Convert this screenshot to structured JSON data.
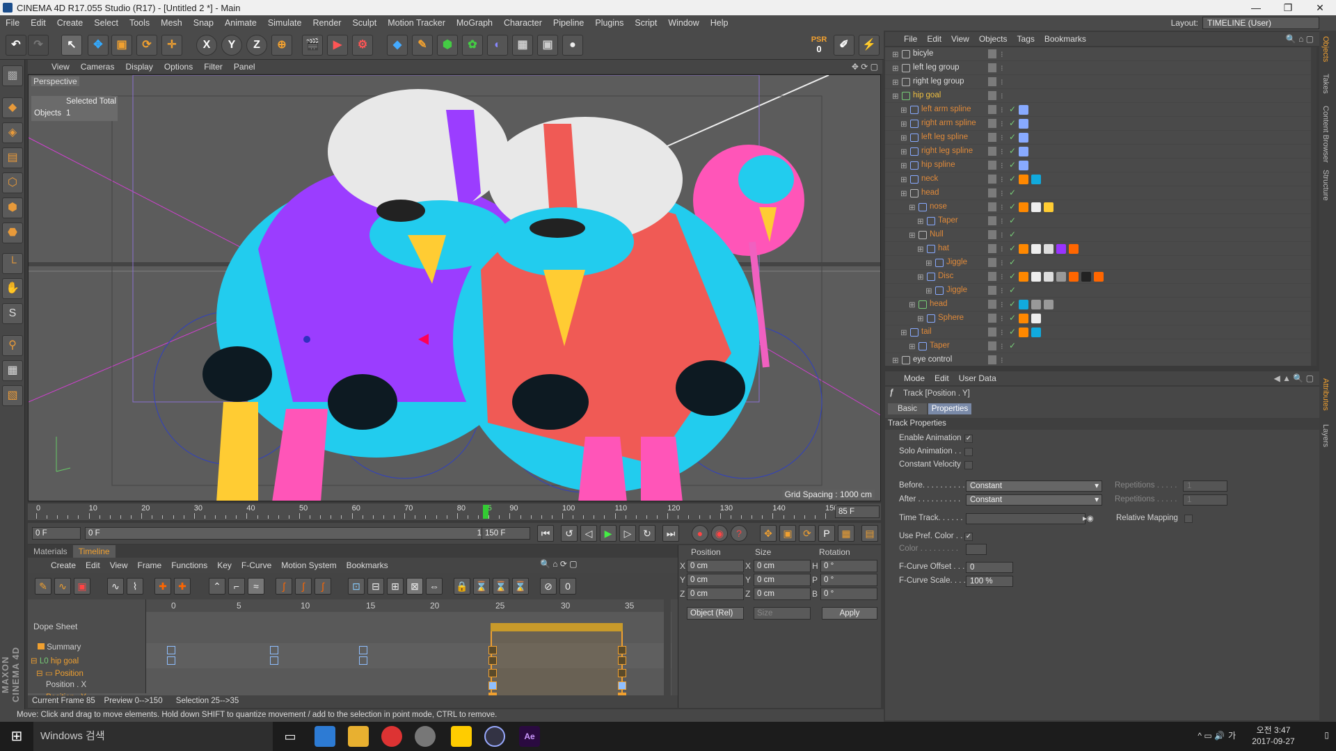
{
  "window": {
    "title": "CINEMA 4D R17.055 Studio (R17) - [Untitled 2 *] - Main",
    "min": "—",
    "max": "❐",
    "close": "✕"
  },
  "menu": [
    "File",
    "Edit",
    "Create",
    "Select",
    "Tools",
    "Mesh",
    "Snap",
    "Animate",
    "Simulate",
    "Render",
    "Sculpt",
    "Motion Tracker",
    "MoGraph",
    "Character",
    "Pipeline",
    "Plugins",
    "Script",
    "Window",
    "Help"
  ],
  "layout": {
    "label": "Layout:",
    "value": "TIMELINE (User)"
  },
  "psr": {
    "label": "PSR",
    "value": "0"
  },
  "viewport": {
    "menu": [
      "View",
      "Cameras",
      "Display",
      "Options",
      "Filter",
      "Panel"
    ],
    "label": "Perspective",
    "hud_header": "Selected Total",
    "hud_label": "Objects",
    "hud_value": "1",
    "grid_spacing": "Grid Spacing : 1000 cm"
  },
  "ruler": {
    "ticks": [
      "0",
      "10",
      "20",
      "30",
      "40",
      "50",
      "60",
      "70",
      "80",
      "85",
      "90",
      "100",
      "110",
      "120",
      "130",
      "140",
      "150"
    ],
    "current_frame": "85 F"
  },
  "transport": {
    "start": "0 F",
    "range_start": "0 F",
    "range_end": "150 F",
    "end": "150 F"
  },
  "bottom_tabs": [
    "Materials",
    "Timeline"
  ],
  "timeline_menu": [
    "Create",
    "Edit",
    "View",
    "Frame",
    "Functions",
    "Key",
    "F-Curve",
    "Motion System",
    "Bookmarks"
  ],
  "dope": {
    "title": "Dope Sheet",
    "ticks": [
      "0",
      "5",
      "10",
      "15",
      "20",
      "25",
      "30",
      "35"
    ],
    "tracks": [
      {
        "name": "Summary",
        "color": "#ddd"
      },
      {
        "name": "hip goal",
        "color": "#f0a030"
      },
      {
        "name": "Position",
        "color": "#f0a030"
      },
      {
        "name": "Position . X",
        "color": "#ddd"
      },
      {
        "name": "Position . Y",
        "color": "#f0a030"
      }
    ]
  },
  "timeline_status": {
    "current": "Current Frame  85",
    "preview": "Preview  0-->150",
    "selection": "Selection 25-->35"
  },
  "coords": {
    "headers": [
      "Position",
      "Size",
      "Rotation"
    ],
    "rows": [
      {
        "a": "X",
        "av": "0 cm",
        "b": "X",
        "bv": "0 cm",
        "c": "H",
        "cv": "0 °"
      },
      {
        "a": "Y",
        "av": "0 cm",
        "b": "Y",
        "bv": "0 cm",
        "c": "P",
        "cv": "0 °"
      },
      {
        "a": "Z",
        "av": "0 cm",
        "b": "Z",
        "bv": "0 cm",
        "c": "B",
        "cv": "0 °"
      }
    ],
    "mode": "Object (Rel)",
    "size_mode": "Size",
    "apply": "Apply"
  },
  "status": "Move: Click and drag to move elements. Hold down SHIFT to quantize movement / add to the selection in point mode, CTRL to remove.",
  "maxon": "MAXON CINEMA 4D",
  "objects_menu": [
    "File",
    "Edit",
    "View",
    "Objects",
    "Tags",
    "Bookmarks"
  ],
  "objects": [
    {
      "name": "bicyle",
      "indent": 0,
      "color": "#ddd",
      "icon": "#bbb",
      "tags": []
    },
    {
      "name": "left leg group",
      "indent": 0,
      "color": "#ddd",
      "icon": "#bbb",
      "tags": []
    },
    {
      "name": "right leg group",
      "indent": 0,
      "color": "#ddd",
      "icon": "#bbb",
      "tags": []
    },
    {
      "name": "hip goal",
      "indent": 0,
      "color": "#f0c040",
      "icon": "#7c7",
      "tags": []
    },
    {
      "name": "left arm spline",
      "indent": 1,
      "color": "#e08a3a",
      "icon": "#8af",
      "tags": [
        "#8af"
      ]
    },
    {
      "name": "right arm spline",
      "indent": 1,
      "color": "#e08a3a",
      "icon": "#8af",
      "tags": [
        "#8af"
      ]
    },
    {
      "name": "left leg spline",
      "indent": 1,
      "color": "#e08a3a",
      "icon": "#8af",
      "tags": [
        "#8af"
      ]
    },
    {
      "name": "right leg spline",
      "indent": 1,
      "color": "#e08a3a",
      "icon": "#8af",
      "tags": [
        "#8af"
      ]
    },
    {
      "name": "hip spline",
      "indent": 1,
      "color": "#e08a3a",
      "icon": "#8af",
      "tags": [
        "#8af"
      ]
    },
    {
      "name": "neck",
      "indent": 1,
      "color": "#e08a3a",
      "icon": "#8af",
      "tags": [
        "#f80",
        "#1ad"
      ]
    },
    {
      "name": "head",
      "indent": 1,
      "color": "#e08a3a",
      "icon": "#bbb",
      "tags": []
    },
    {
      "name": "nose",
      "indent": 2,
      "color": "#e08a3a",
      "icon": "#8af",
      "tags": [
        "#f80",
        "#eee",
        "#fc3"
      ]
    },
    {
      "name": "Taper",
      "indent": 3,
      "color": "#e08a3a",
      "icon": "#8af",
      "tags": []
    },
    {
      "name": "Null",
      "indent": 2,
      "color": "#e08a3a",
      "icon": "#bbb",
      "tags": []
    },
    {
      "name": "hat",
      "indent": 3,
      "color": "#e08a3a",
      "icon": "#8af",
      "tags": [
        "#f80",
        "#eee",
        "#ddd",
        "#93f",
        "#f60"
      ]
    },
    {
      "name": "Jiggle",
      "indent": 4,
      "color": "#e08a3a",
      "icon": "#8af",
      "tags": []
    },
    {
      "name": "Disc",
      "indent": 3,
      "color": "#e08a3a",
      "icon": "#8af",
      "tags": [
        "#f80",
        "#eee",
        "#ddd",
        "#999",
        "#f60",
        "#222",
        "#f60"
      ]
    },
    {
      "name": "Jiggle",
      "indent": 4,
      "color": "#e08a3a",
      "icon": "#8af",
      "tags": []
    },
    {
      "name": "head",
      "indent": 2,
      "color": "#e08a3a",
      "icon": "#7c7",
      "tags": [
        "#1ad",
        "#999",
        "#999"
      ]
    },
    {
      "name": "Sphere",
      "indent": 3,
      "color": "#e08a3a",
      "icon": "#8af",
      "tags": [
        "#f80",
        "#eee"
      ]
    },
    {
      "name": "tail",
      "indent": 1,
      "color": "#e08a3a",
      "icon": "#8af",
      "tags": [
        "#f80",
        "#1ad"
      ]
    },
    {
      "name": "Taper",
      "indent": 2,
      "color": "#e08a3a",
      "icon": "#8af",
      "tags": []
    },
    {
      "name": "eye control",
      "indent": 0,
      "color": "#ddd",
      "icon": "#bbb",
      "tags": []
    }
  ],
  "attr_menu": [
    "Mode",
    "Edit",
    "User Data"
  ],
  "attr": {
    "header": "Track [Position . Y]",
    "tabs": [
      "Basic",
      "Properties"
    ],
    "section": "Track Properties",
    "enable_animation": "Enable Animation",
    "solo_animation": "Solo Animation . .",
    "constant_velocity": "Constant Velocity",
    "before_label": "Before. . . . . . . . . .",
    "before_value": "Constant",
    "after_label": "After . . . . . . . . . .",
    "after_value": "Constant",
    "repetitions_label": "Repetitions . . . . .",
    "repetitions_value": "1",
    "time_track_label": "Time Track. . . . . .",
    "relative_mapping": "Relative Mapping",
    "use_pref_color": "Use Pref. Color . .",
    "color_label": "Color . . . . . . . . .",
    "fcurve_offset_label": "F-Curve Offset . . .",
    "fcurve_offset_value": "0",
    "fcurve_scale_label": "F-Curve Scale. . . .",
    "fcurve_scale_value": "100 %"
  },
  "right_strip": [
    "Objects",
    "Takes",
    "Content Browser",
    "Structure",
    "Attributes",
    "Layers"
  ],
  "taskbar": {
    "search": "Windows 검색",
    "time": "오전 3:47",
    "date": "2017-09-27",
    "ime": "가"
  }
}
